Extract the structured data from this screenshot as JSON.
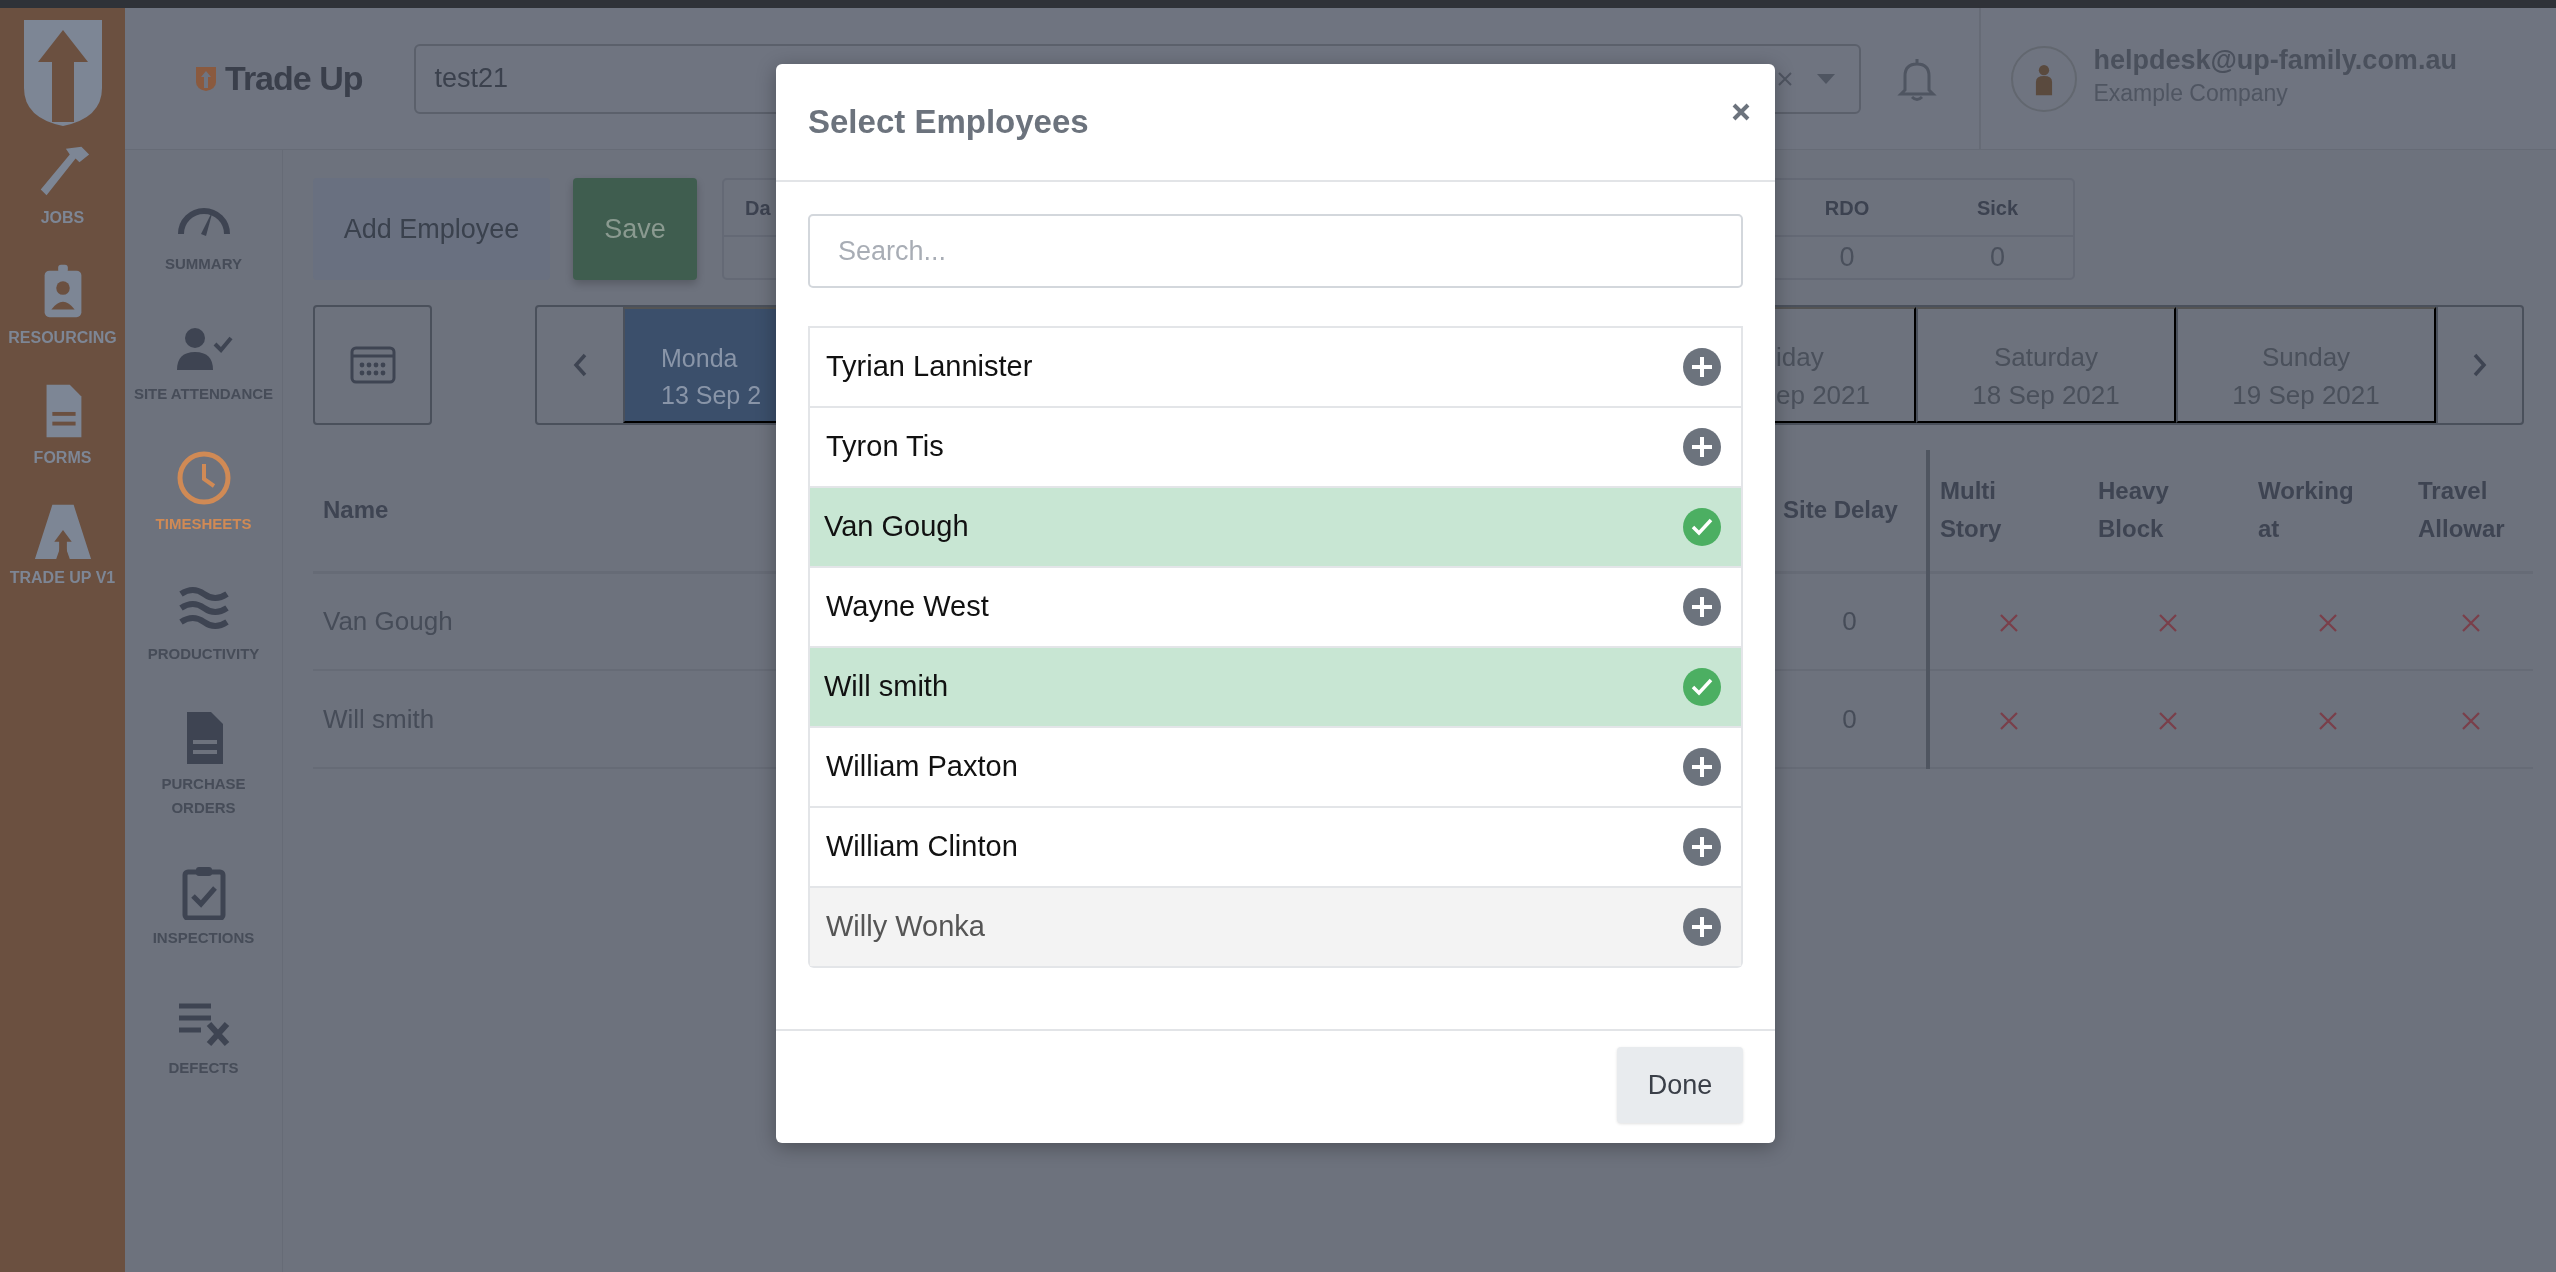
{
  "app_sidebar": {
    "items": [
      {
        "label": "JOBS"
      },
      {
        "label": "RESOURCING"
      },
      {
        "label": "FORMS"
      },
      {
        "label": "TRADE UP V1"
      }
    ]
  },
  "header": {
    "logo_text": "Trade Up",
    "job_select": {
      "value": "test21"
    },
    "user": {
      "email": "helpdesk@up-family.com.au",
      "company": "Example Company"
    }
  },
  "module_sidebar": {
    "items": [
      {
        "label": "SUMMARY",
        "selected": false
      },
      {
        "label": "SITE ATTENDANCE",
        "selected": false
      },
      {
        "label": "TIMESHEETS",
        "selected": true
      },
      {
        "label": "PRODUCTIVITY",
        "selected": false
      },
      {
        "label": "PURCHASE ORDERS",
        "selected": false
      },
      {
        "label": "INSPECTIONS",
        "selected": false
      },
      {
        "label": "DEFECTS",
        "selected": false
      }
    ]
  },
  "toolbar": {
    "buttons": [
      {
        "label": "Add Employee",
        "kind": "secondary"
      },
      {
        "label": "Save",
        "kind": "success"
      }
    ]
  },
  "stats": [
    {
      "label": "Da"
    },
    {
      "label": "RDO",
      "value": "0"
    },
    {
      "label": "Sick",
      "value": "0"
    }
  ],
  "days": [
    {
      "day": "Monda",
      "date": "13 Sep 2",
      "selected": true
    },
    {
      "day": "iday",
      "date": "ep 2021",
      "selected": false
    },
    {
      "day": "Saturday",
      "date": "18 Sep 2021",
      "selected": false
    },
    {
      "day": "Sunday",
      "date": "19 Sep 2021",
      "selected": false
    }
  ],
  "table": {
    "columns": [
      "Name",
      "Site Delay",
      "Multi Story",
      "Heavy Block",
      "Working at",
      "Travel Allowar"
    ],
    "rows": [
      {
        "name": "Van Gough",
        "site_delay": "0",
        "allowances": [
          false,
          false,
          false,
          false
        ]
      },
      {
        "name": "Will smith",
        "site_delay": "0",
        "allowances": [
          false,
          false,
          false,
          false
        ]
      }
    ]
  },
  "modal": {
    "title": "Select Employees",
    "search": {
      "placeholder": "Search..."
    },
    "employees": [
      {
        "name": "Tyrian Lannister",
        "selected": false,
        "hovered": false
      },
      {
        "name": "Tyron Tis",
        "selected": false,
        "hovered": false
      },
      {
        "name": "Van Gough",
        "selected": true,
        "hovered": false
      },
      {
        "name": "Wayne West",
        "selected": false,
        "hovered": false
      },
      {
        "name": "Will smith",
        "selected": true,
        "hovered": false
      },
      {
        "name": "William Paxton",
        "selected": false,
        "hovered": false
      },
      {
        "name": "William Clinton",
        "selected": false,
        "hovered": false
      },
      {
        "name": "Willy Wonka",
        "selected": false,
        "hovered": true
      }
    ],
    "done_button": "Done"
  }
}
